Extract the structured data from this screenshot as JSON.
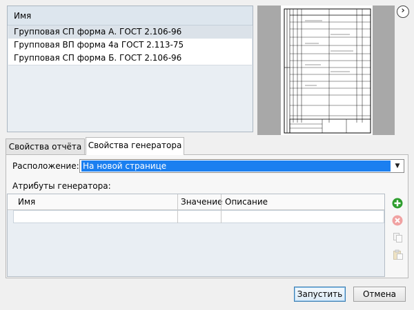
{
  "templates": {
    "header": "Имя",
    "rows": [
      {
        "name": "Групповая СП форма А. ГОСТ 2.106-96",
        "selected": true
      },
      {
        "name": "Групповая ВП форма 4а ГОСТ 2.113-75",
        "selected": false
      },
      {
        "name": "Групповая СП форма Б. ГОСТ 2.106-96",
        "selected": false
      }
    ]
  },
  "preview": {
    "nav_icon": "chevron-right-icon",
    "nav_glyph": "›"
  },
  "tabs": [
    {
      "label": "Свойства отчёта",
      "active": false
    },
    {
      "label": "Свойства генератора",
      "active": true
    }
  ],
  "location": {
    "label": "Расположение:",
    "value": "На новой странице"
  },
  "attributes": {
    "label": "Атрибуты генератора:",
    "columns": [
      "Имя",
      "Значение",
      "Описание"
    ]
  },
  "actions": {
    "add_icon": "add-icon",
    "delete_icon": "delete-icon",
    "copy_icon": "copy-icon",
    "paste_icon": "paste-icon"
  },
  "buttons": {
    "run": "Запустить",
    "cancel": "Отмена"
  },
  "colors": {
    "selection": "#1b7ff0",
    "add": "#2e9e2e",
    "delete": "#f08c8c"
  }
}
